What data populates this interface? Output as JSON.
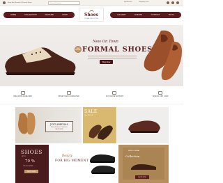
{
  "topbar": {
    "welcome": "Shop Best Brands Of Formal Shoes",
    "phone": "(000) 1234 5678",
    "search_placeholder": "Search Products...",
    "account": "My Account",
    "shipping": "Shipping Price",
    "cart_count": "0"
  },
  "logo": {
    "word": "Shoes",
    "tagline": "FORMAL SHOE STORE"
  },
  "nav": {
    "left": [
      "HOME",
      "COLLECTION",
      "FEATURE",
      "SHOP"
    ],
    "right": [
      "GALLERY",
      "EVENTS",
      "CONTACT",
      "BLOG"
    ]
  },
  "hero": {
    "kicker": "New On Town",
    "title": "FORMAL SHOES",
    "badge": "NEW ARRIVAL",
    "button": "Shop Now"
  },
  "features": [
    "FREE WORLD DELIVERY",
    "MONEY BACK GUARANTEE",
    "24/7 ONLINE SUPPORT",
    "SPECIAL GIFT CARD"
  ],
  "promos": {
    "arrivals": {
      "title": "JUST ARRIVALS",
      "sub": "Formal Shoes Collection",
      "link": "SHOP NOW"
    },
    "sale": {
      "title": "SALE",
      "sub": "Upto 50% Off"
    },
    "shoes": {
      "title": "SHOES",
      "upto": "UPTO",
      "pct": "70 %",
      "sub": "ON ALL SHOES",
      "button": "SHOP NOW"
    },
    "moment": {
      "script": "Beauty",
      "title": "FOR BIG MOMENT"
    },
    "shop": {
      "sub": "MEN'S FORMAL",
      "title": "Collection",
      "button": "SHOP NOW"
    }
  },
  "colors": {
    "primary": "#5c1a1e",
    "accent": "#c19a6b",
    "hero_bg": "#ece9e6"
  }
}
